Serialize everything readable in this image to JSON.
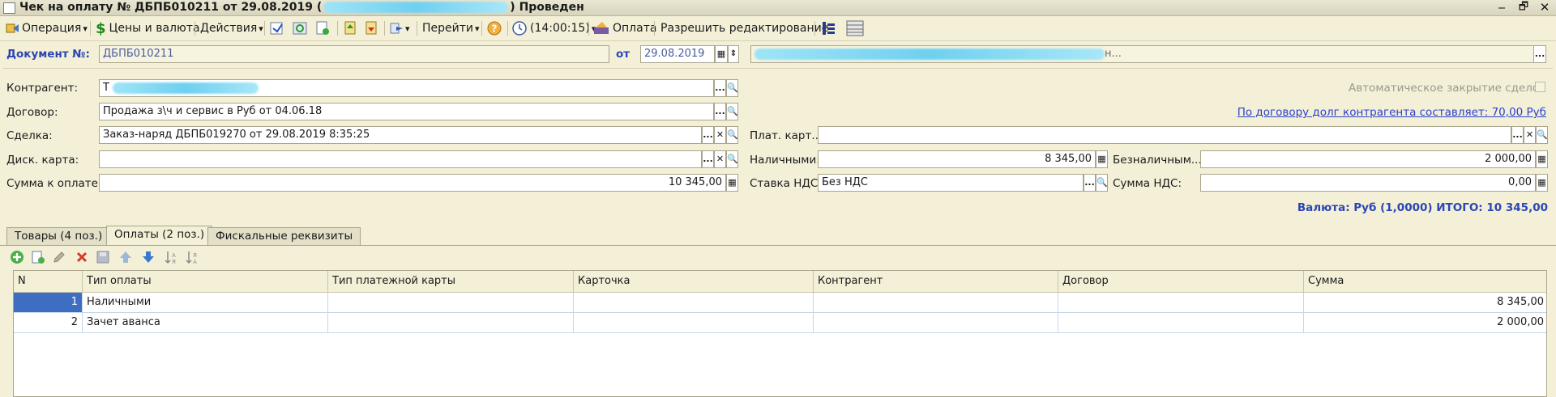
{
  "window": {
    "title_prefix": "Чек на оплату № ДБПБ010211 от 29.08.2019 (",
    "title_suffix": ") Проведен",
    "btn_minimize": "‒",
    "btn_restore": "🗗",
    "btn_close": "✕"
  },
  "toolbar": {
    "operation": "Операция",
    "prices": "Цены и валюта",
    "actions": "Действия",
    "goto": "Перейти",
    "time": "(14:00:15)",
    "payment": "Оплата",
    "allow_edit": "Разрешить редактирование",
    "dropdown_arrow": "▾"
  },
  "header": {
    "doc_label": "Документ №:",
    "doc_number": "ДБПБ010211",
    "date_label": "от",
    "date_value": "29.08.2019",
    "org_tail": "н..."
  },
  "form": {
    "counterparty_label": "Контрагент:",
    "counterparty_value": "Т",
    "contract_label": "Договор:",
    "contract_value": "Продажа з\\ч и сервис в Руб от 04.06.18",
    "deal_label": "Сделка:",
    "deal_value": "Заказ-наряд ДБПБ019270 от 29.08.2019 8:35:25",
    "disc_card_label": "Диск. карта:",
    "disc_card_value": "",
    "sum_label": "Сумма к оплате:",
    "sum_value": "10 345,00",
    "auto_close_label": "Автоматическое закрытие сделок",
    "debt_link": "По договору долг контрагента составляет: 70,00 Руб",
    "pay_card_label": "Плат. карт...",
    "pay_card_value": "",
    "cash_label": "Наличными:",
    "cash_value": "8 345,00",
    "noncash_label": "Безналичным...",
    "noncash_value": "2 000,00",
    "vat_rate_label": "Ставка НДС:",
    "vat_rate_value": "Без НДС",
    "vat_sum_label": "Сумма НДС:",
    "vat_sum_value": "0,00",
    "currency_total": "Валюта: Руб (1,0000) ИТОГО: 10 345,00",
    "btn_dots": "...",
    "btn_clear": "✕",
    "btn_search": "🔍",
    "btn_calc": "▦",
    "btn_cal": "▦",
    "btn_spin": "⇕"
  },
  "tabs": [
    {
      "label": "Товары (4 поз.)"
    },
    {
      "label": "Оплаты (2 поз.)"
    },
    {
      "label": "Фискальные реквизиты"
    }
  ],
  "table": {
    "columns": [
      "N",
      "Тип оплаты",
      "Тип платежной карты",
      "Карточка",
      "Контрагент",
      "Договор",
      "Сумма"
    ],
    "rows": [
      {
        "n": "1",
        "type": "Наличными",
        "card_type": "",
        "card": "",
        "counterparty": "",
        "contract": "",
        "sum": "8 345,00"
      },
      {
        "n": "2",
        "type": "Зачет аванса",
        "card_type": "",
        "card": "",
        "counterparty": "",
        "contract": "",
        "sum": "2 000,00"
      }
    ]
  },
  "colors": {
    "background": "#f4f0d8",
    "accent_blue": "#2b46b3",
    "selection": "#3e6ec2"
  }
}
